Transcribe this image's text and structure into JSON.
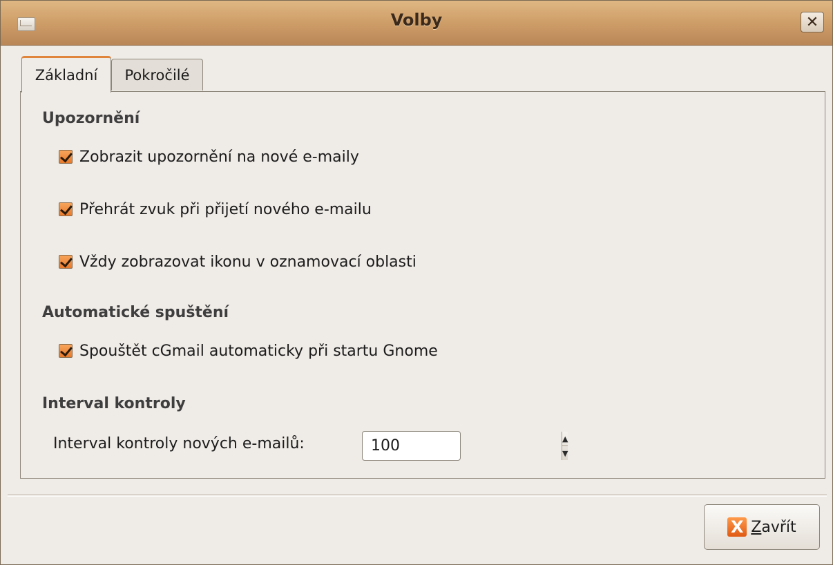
{
  "window": {
    "title": "Volby",
    "close_symbol": "✕",
    "window_icon": "mail-icon"
  },
  "tabs": [
    {
      "label": "Základní",
      "active": true
    },
    {
      "label": "Pokročilé",
      "active": false
    }
  ],
  "sections": {
    "notifications": {
      "title": "Upozornění",
      "options": [
        {
          "label": "Zobrazit upozornění na nové e-maily",
          "checked": true
        },
        {
          "label": "Přehrát zvuk při přijetí nového e-mailu",
          "checked": true
        },
        {
          "label": "Vždy zobrazovat ikonu v oznamovací oblasti",
          "checked": true
        }
      ]
    },
    "autostart": {
      "title": "Automatické spuštění",
      "options": [
        {
          "label": "Spouštět cGmail automaticky při startu Gnome",
          "checked": true
        }
      ]
    },
    "interval": {
      "title": "Interval kontroly",
      "label": "Interval kontroly nových e-mailů:",
      "value": "100"
    }
  },
  "footer": {
    "close_button_mnemonic": "Z",
    "close_button_rest": "avřít",
    "close_icon_glyph": "X"
  },
  "colors": {
    "accent": "#e87a2c",
    "titlebar": "#d0a06a",
    "background": "#efebe7"
  }
}
